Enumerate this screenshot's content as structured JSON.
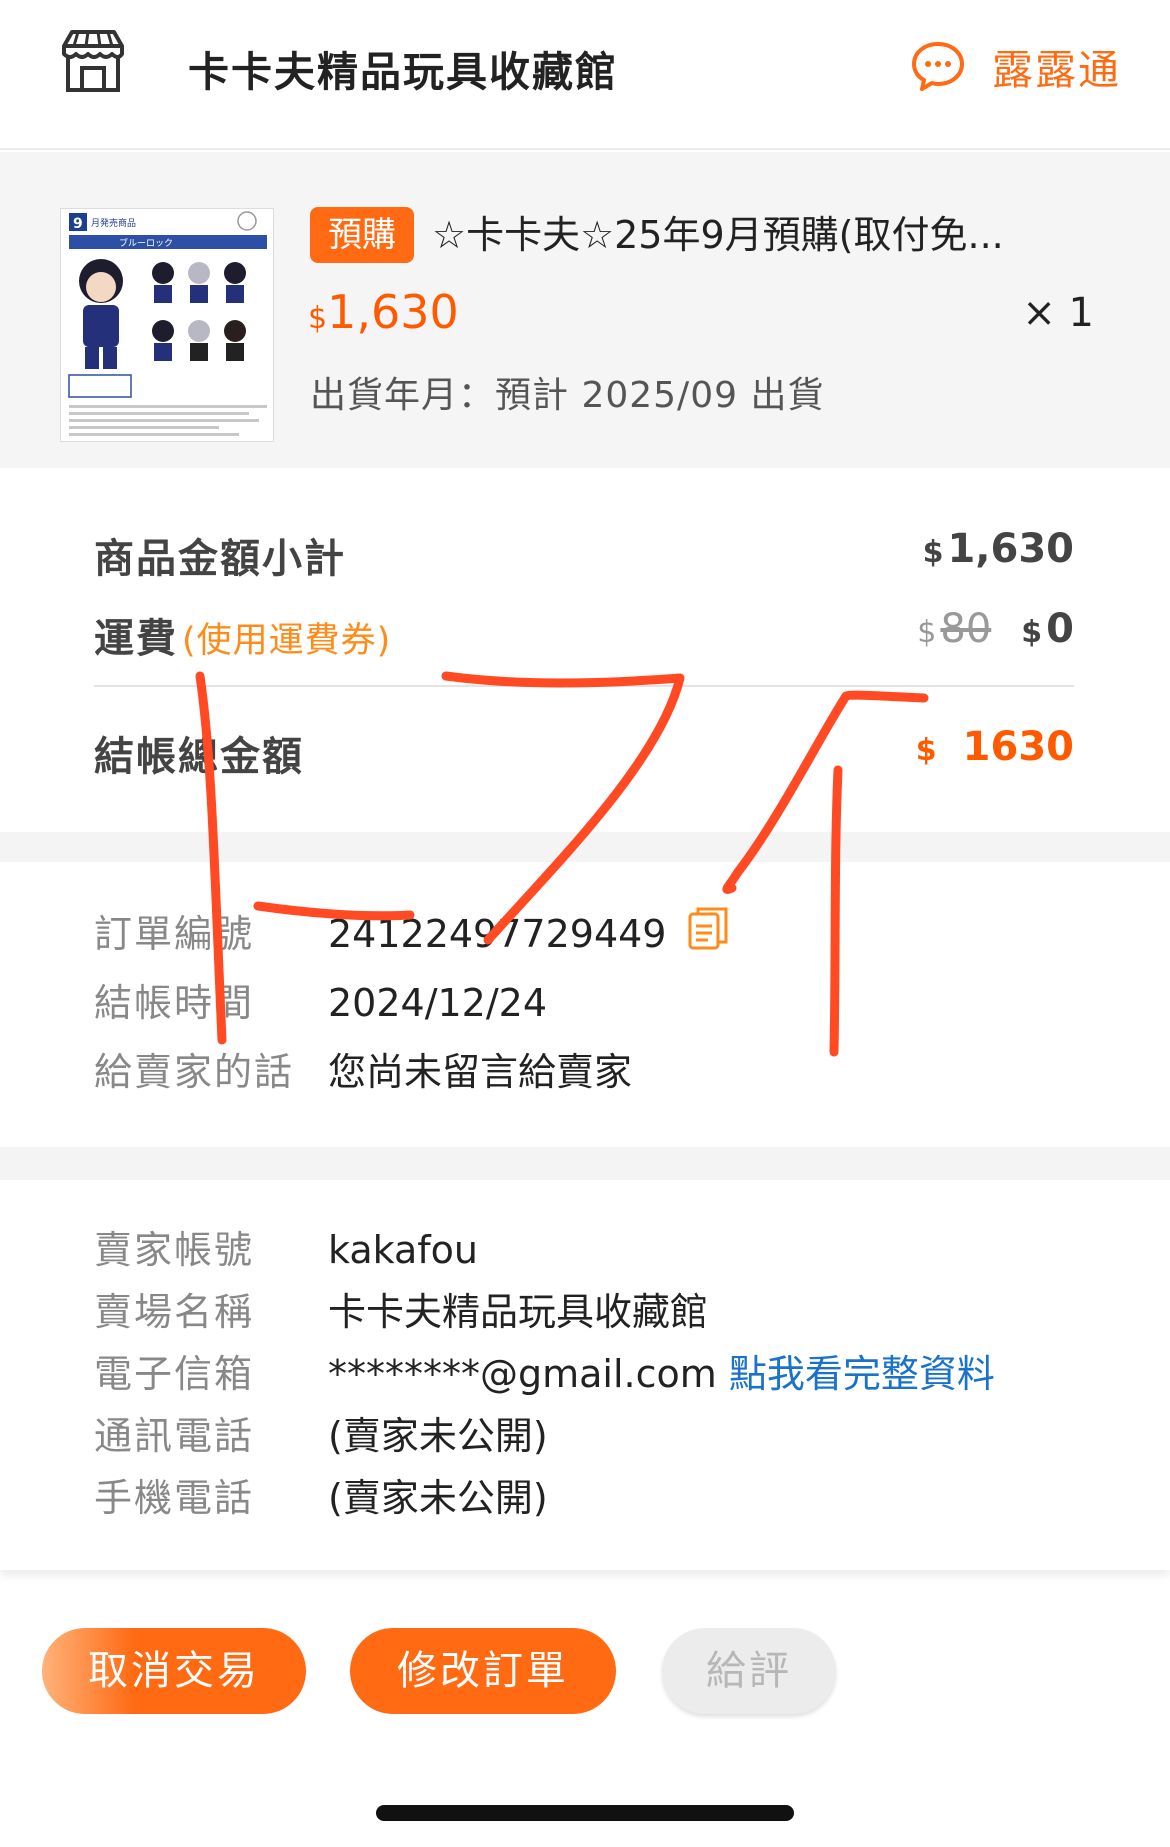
{
  "header": {
    "shop_name": "卡卡夫精品玩具收藏館",
    "chat_label": "露露通",
    "icons": {
      "shop": "storefront-icon",
      "chat": "chat-bubble-icon"
    }
  },
  "product": {
    "badge": "預購",
    "title": "☆卡卡夫☆25年9月預購(取付免...",
    "price_currency": "$",
    "price": "1,630",
    "quantity": "× 1",
    "ship_date": "出貨年月：預計 2025/09 出貨",
    "thumbnail": {
      "corner_number": "9",
      "corner_text": "月発売商品",
      "banner_text": "ブルーロック"
    }
  },
  "summary": {
    "subtotal_label": "商品金額小計",
    "subtotal_currency": "$",
    "subtotal_value": "1,630",
    "shipping_label": "運費",
    "shipping_coupon": "(使用運費券)",
    "shipping_orig_currency": "$",
    "shipping_orig_value": "80",
    "shipping_currency": "$",
    "shipping_value": "0",
    "total_label": "結帳總金額",
    "total_currency": "$",
    "total_value": "1630"
  },
  "order_info": {
    "order_no_label": "訂單編號",
    "order_no_value": "24122497729449",
    "checkout_time_label": "結帳時間",
    "checkout_time_value": "2024/12/24",
    "message_label": "給賣家的話",
    "message_value": "您尚未留言給賣家"
  },
  "seller_info": {
    "account_label": "賣家帳號",
    "account_value": "kakafou",
    "store_label": "賣場名稱",
    "store_value": "卡卡夫精品玩具收藏館",
    "email_label": "電子信箱",
    "email_value": "********@gmail.com",
    "email_link": "點我看完整資料",
    "phone_label": "通訊電話",
    "phone_value": "(賣家未公開)",
    "mobile_label": "手機電話",
    "mobile_value": "(賣家未公開)"
  },
  "actions": {
    "cancel_label": "取消交易",
    "edit_label": "修改訂單",
    "rate_label": "給評"
  },
  "colors": {
    "accent": "#ff6a13",
    "price": "#ff5a00",
    "link": "#1a73c8",
    "annotation": "#ff4a24"
  },
  "annotation": {
    "text": "L7イ"
  }
}
